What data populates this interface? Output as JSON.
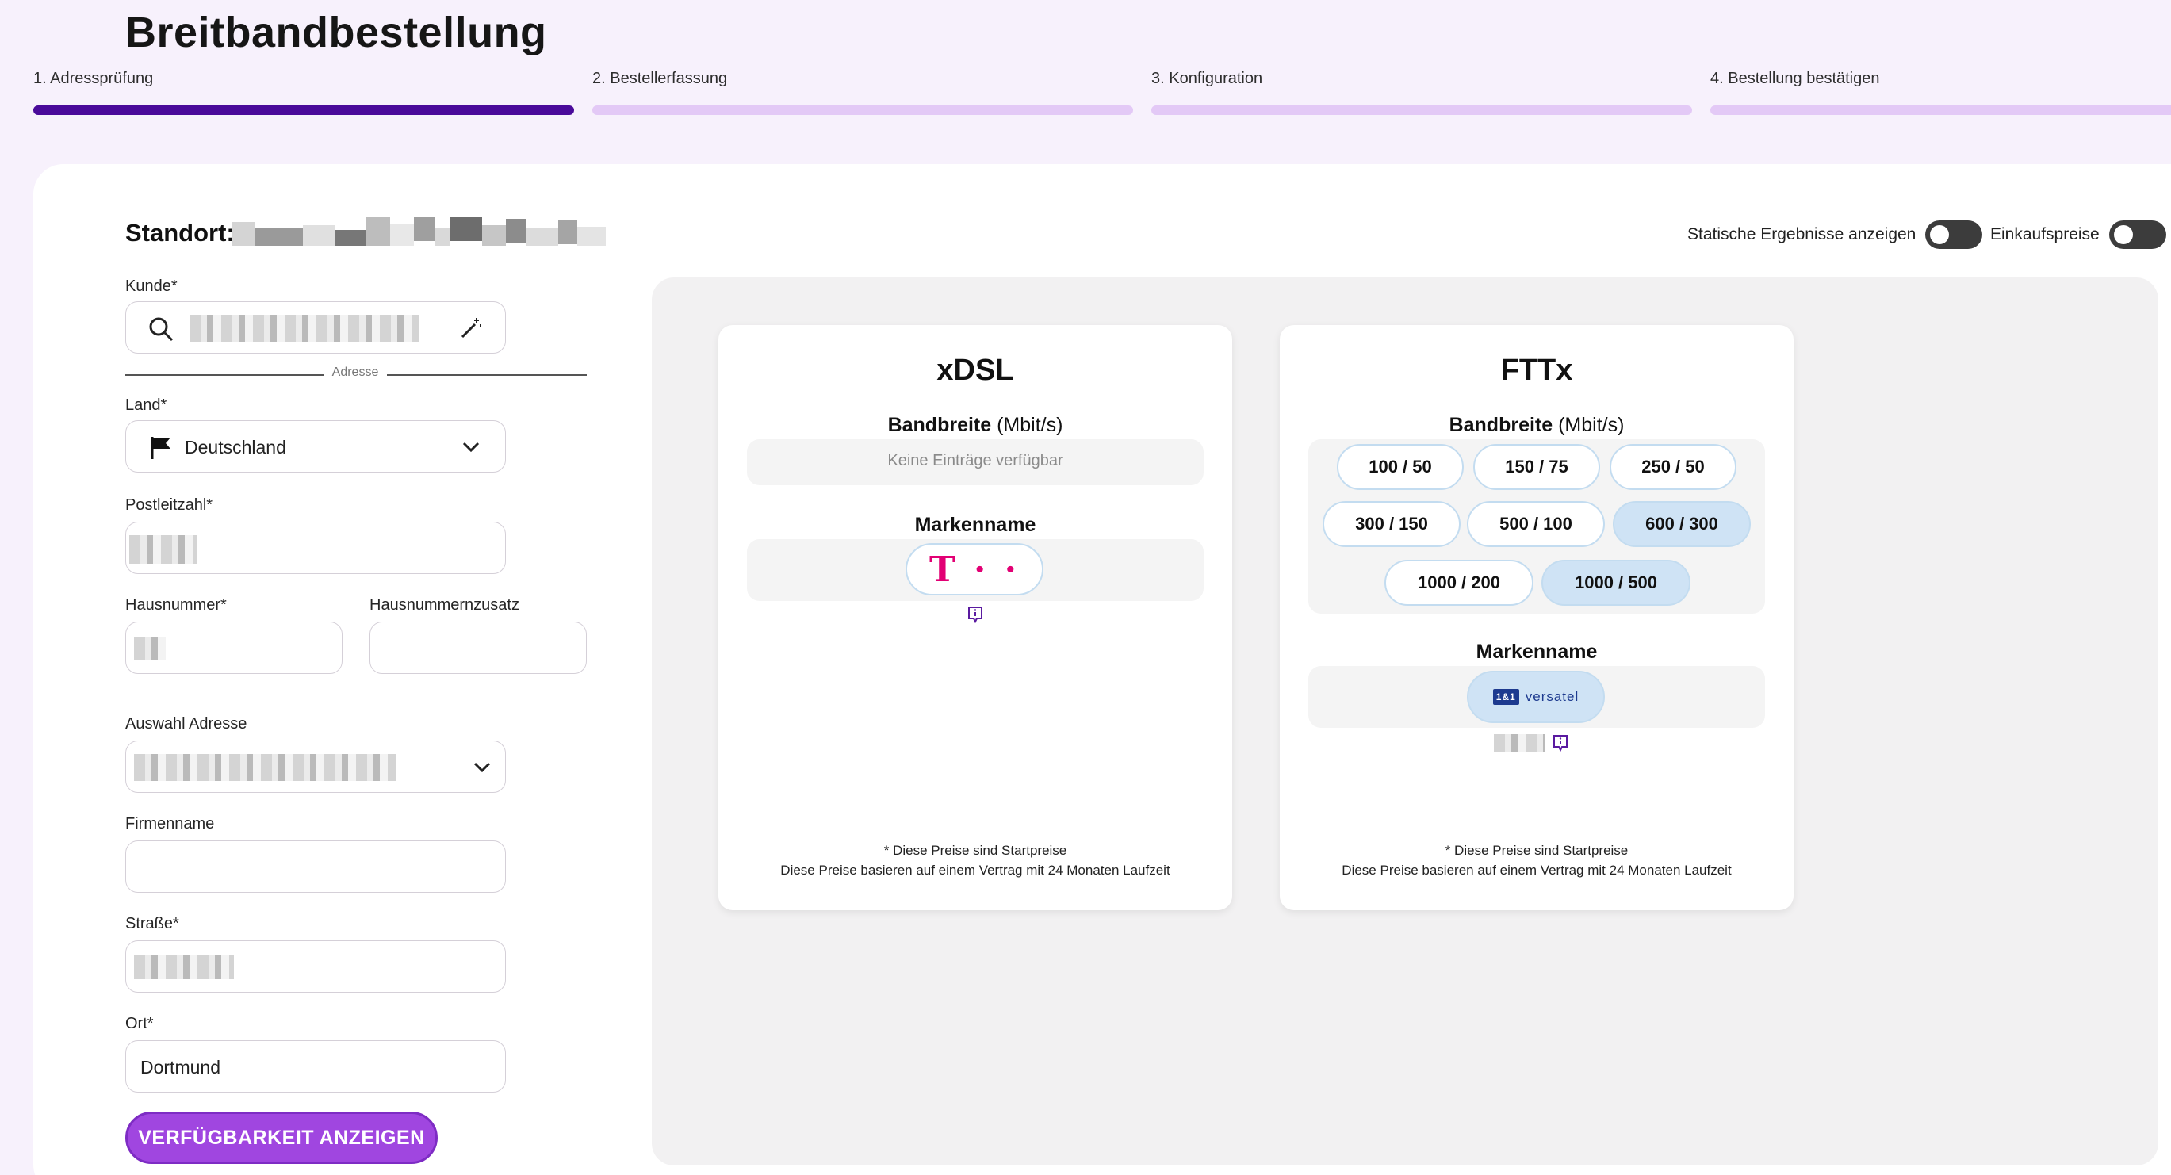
{
  "page": {
    "title": "Breitbandbestellung"
  },
  "steps": [
    {
      "label": "1. Adressprüfung",
      "active": true
    },
    {
      "label": "2. Bestellerfassung",
      "active": false
    },
    {
      "label": "3. Konfiguration",
      "active": false
    },
    {
      "label": "4. Bestellung bestätigen",
      "active": false
    }
  ],
  "location": {
    "label": "Standort:"
  },
  "toggles": {
    "static_results": "Statische Ergebnisse anzeigen",
    "purchase_prices": "Einkaufspreise"
  },
  "form": {
    "customer_label": "Kunde*",
    "address_divider": "Adresse",
    "country_label": "Land*",
    "country_value": "Deutschland",
    "postcode_label": "Postleitzahl*",
    "house_number_label": "Hausnummer*",
    "house_number_suffix_label": "Hausnummernzusatz",
    "address_select_label": "Auswahl Adresse",
    "company_label": "Firmenname",
    "street_label": "Straße*",
    "city_label": "Ort*",
    "city_value": "Dortmund",
    "submit_label": "VERFÜGBARKEIT ANZEIGEN"
  },
  "technologies": [
    {
      "title": "xDSL",
      "bandwidth_label": "Bandbreite",
      "bandwidth_unit": "(Mbit/s)",
      "empty_text": "Keine Einträge verfügbar",
      "brand_label": "Markenname",
      "brand": "T · ·",
      "note_line1": "* Diese Preise sind Startpreise",
      "note_line2": "Diese Preise basieren auf einem Vertrag mit 24 Monaten Laufzeit"
    },
    {
      "title": "FTTx",
      "bandwidth_label": "Bandbreite",
      "bandwidth_unit": "(Mbit/s)",
      "options": [
        "100 / 50",
        "150 / 75",
        "250 / 50",
        "300 / 150",
        "500 / 100",
        "600 / 300",
        "1000 / 200",
        "1000 / 500"
      ],
      "selected": [
        "600 / 300",
        "1000 / 500"
      ],
      "brand_label": "Markenname",
      "brand_badge": "1&1",
      "brand": "versatel",
      "note_line1": "* Diese Preise sind Startpreise",
      "note_line2": "Diese Preise basieren auf einem Vertrag mit 24 Monaten Laufzeit"
    }
  ],
  "colors": {
    "accent": "#4a0a9a",
    "button": "#a046e0",
    "step_inactive": "#e3c9f6",
    "telekom": "#e20074",
    "versatel": "#1d3a8f"
  }
}
